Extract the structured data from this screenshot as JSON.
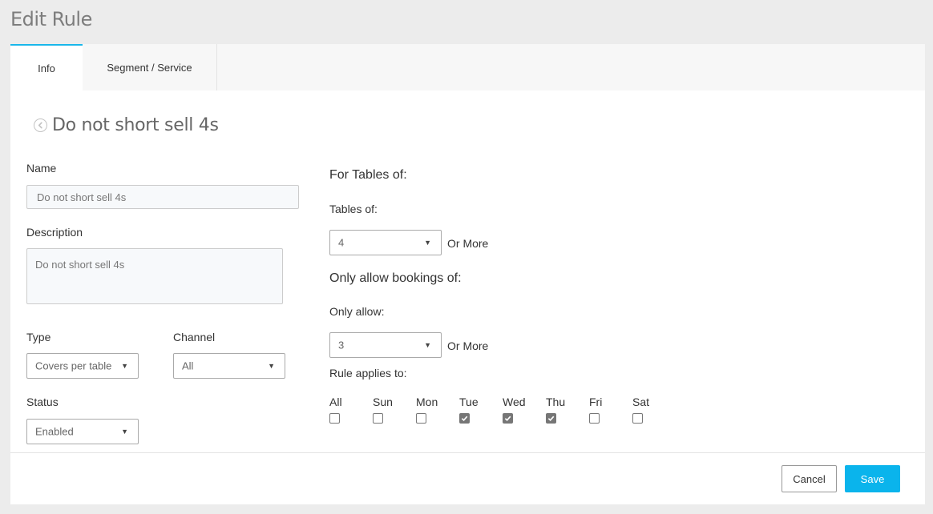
{
  "page": {
    "title": "Edit Rule"
  },
  "tabs": [
    {
      "label": "Info",
      "active": true
    },
    {
      "label": "Segment / Service",
      "active": false
    }
  ],
  "rule": {
    "title": "Do not short sell 4s"
  },
  "form": {
    "name_label": "Name",
    "name_value": "Do not short sell 4s",
    "description_label": "Description",
    "description_value": "Do not short sell 4s",
    "type_label": "Type",
    "type_value": "Covers per table",
    "channel_label": "Channel",
    "channel_value": "All",
    "status_label": "Status",
    "status_value": "Enabled"
  },
  "tables": {
    "heading": "For Tables of:",
    "label": "Tables of:",
    "value": "4",
    "suffix": "Or More"
  },
  "bookings": {
    "heading": "Only allow bookings of:",
    "label": "Only allow:",
    "value": "3",
    "suffix": "Or More"
  },
  "applies": {
    "label": "Rule applies to:",
    "days": [
      {
        "label": "All",
        "checked": false
      },
      {
        "label": "Sun",
        "checked": false
      },
      {
        "label": "Mon",
        "checked": false
      },
      {
        "label": "Tue",
        "checked": true
      },
      {
        "label": "Wed",
        "checked": true
      },
      {
        "label": "Thu",
        "checked": true
      },
      {
        "label": "Fri",
        "checked": false
      },
      {
        "label": "Sat",
        "checked": false
      }
    ]
  },
  "actions": {
    "cancel_label": "Cancel",
    "save_label": "Save"
  },
  "icons": {
    "back": "chevron-left-circle-icon",
    "caret": "caret-down-icon",
    "check": "checkmark-icon"
  },
  "colors": {
    "accent": "#0ab4ec",
    "checkbox_checked": "#767676"
  }
}
